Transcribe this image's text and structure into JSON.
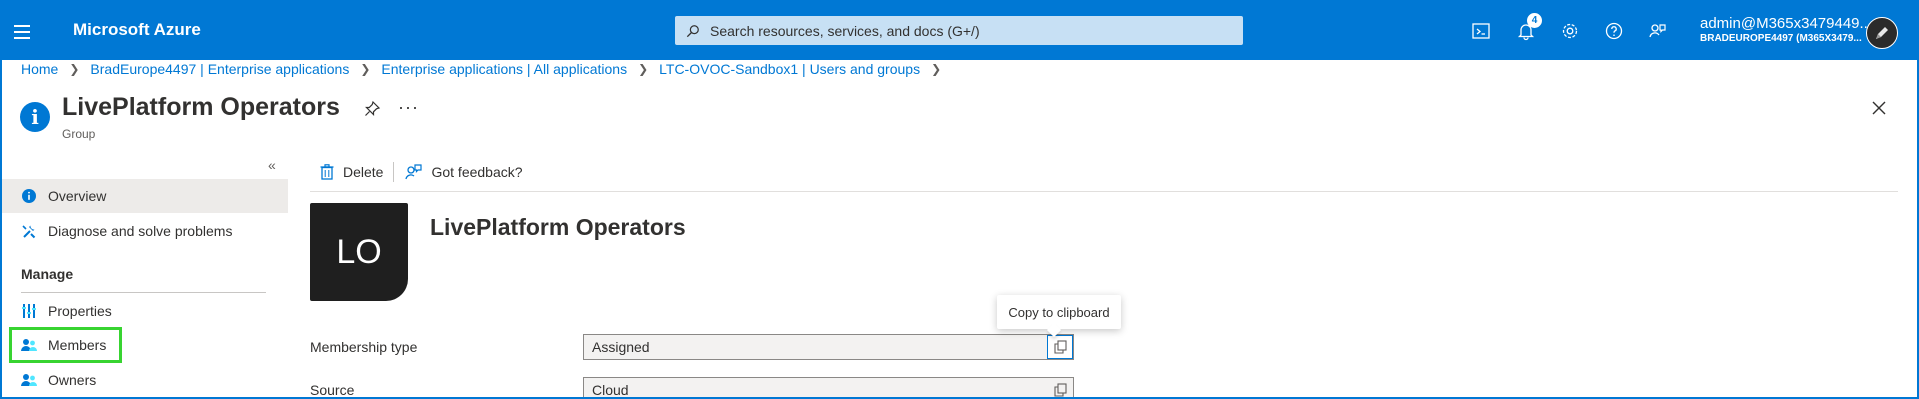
{
  "topbar": {
    "brand": "Microsoft Azure",
    "search_placeholder": "Search resources, services, and docs (G+/)",
    "notification_count": "4",
    "account_name": "admin@M365x3479449...",
    "account_tenant": "BRADEUROPE4497 (M365X3479..."
  },
  "breadcrumb": [
    "Home",
    "BradEurope4497 | Enterprise applications",
    "Enterprise applications | All applications",
    "LTC-OVOC-Sandbox1 | Users and groups"
  ],
  "header": {
    "title": "LivePlatform Operators",
    "subtitle": "Group",
    "more": "···"
  },
  "sidebar": {
    "collapse": "«",
    "items": [
      {
        "label": "Overview",
        "icon": "info-icon",
        "active": true
      },
      {
        "label": "Diagnose and solve problems",
        "icon": "wrench-icon"
      }
    ],
    "section_manage": "Manage",
    "manage_items": [
      {
        "label": "Properties",
        "icon": "properties-icon"
      },
      {
        "label": "Members",
        "icon": "members-icon",
        "highlighted": true
      },
      {
        "label": "Owners",
        "icon": "owners-icon"
      }
    ]
  },
  "commands": {
    "delete": "Delete",
    "feedback": "Got feedback?"
  },
  "group": {
    "initials": "LO",
    "name": "LivePlatform Operators"
  },
  "fields": [
    {
      "label": "Membership type",
      "value": "Assigned"
    },
    {
      "label": "Source",
      "value": "Cloud"
    }
  ],
  "tooltip": "Copy to clipboard",
  "colors": {
    "accent": "#0078d4",
    "highlight": "#38d431",
    "avatar_bg": "#1f1f1f"
  }
}
